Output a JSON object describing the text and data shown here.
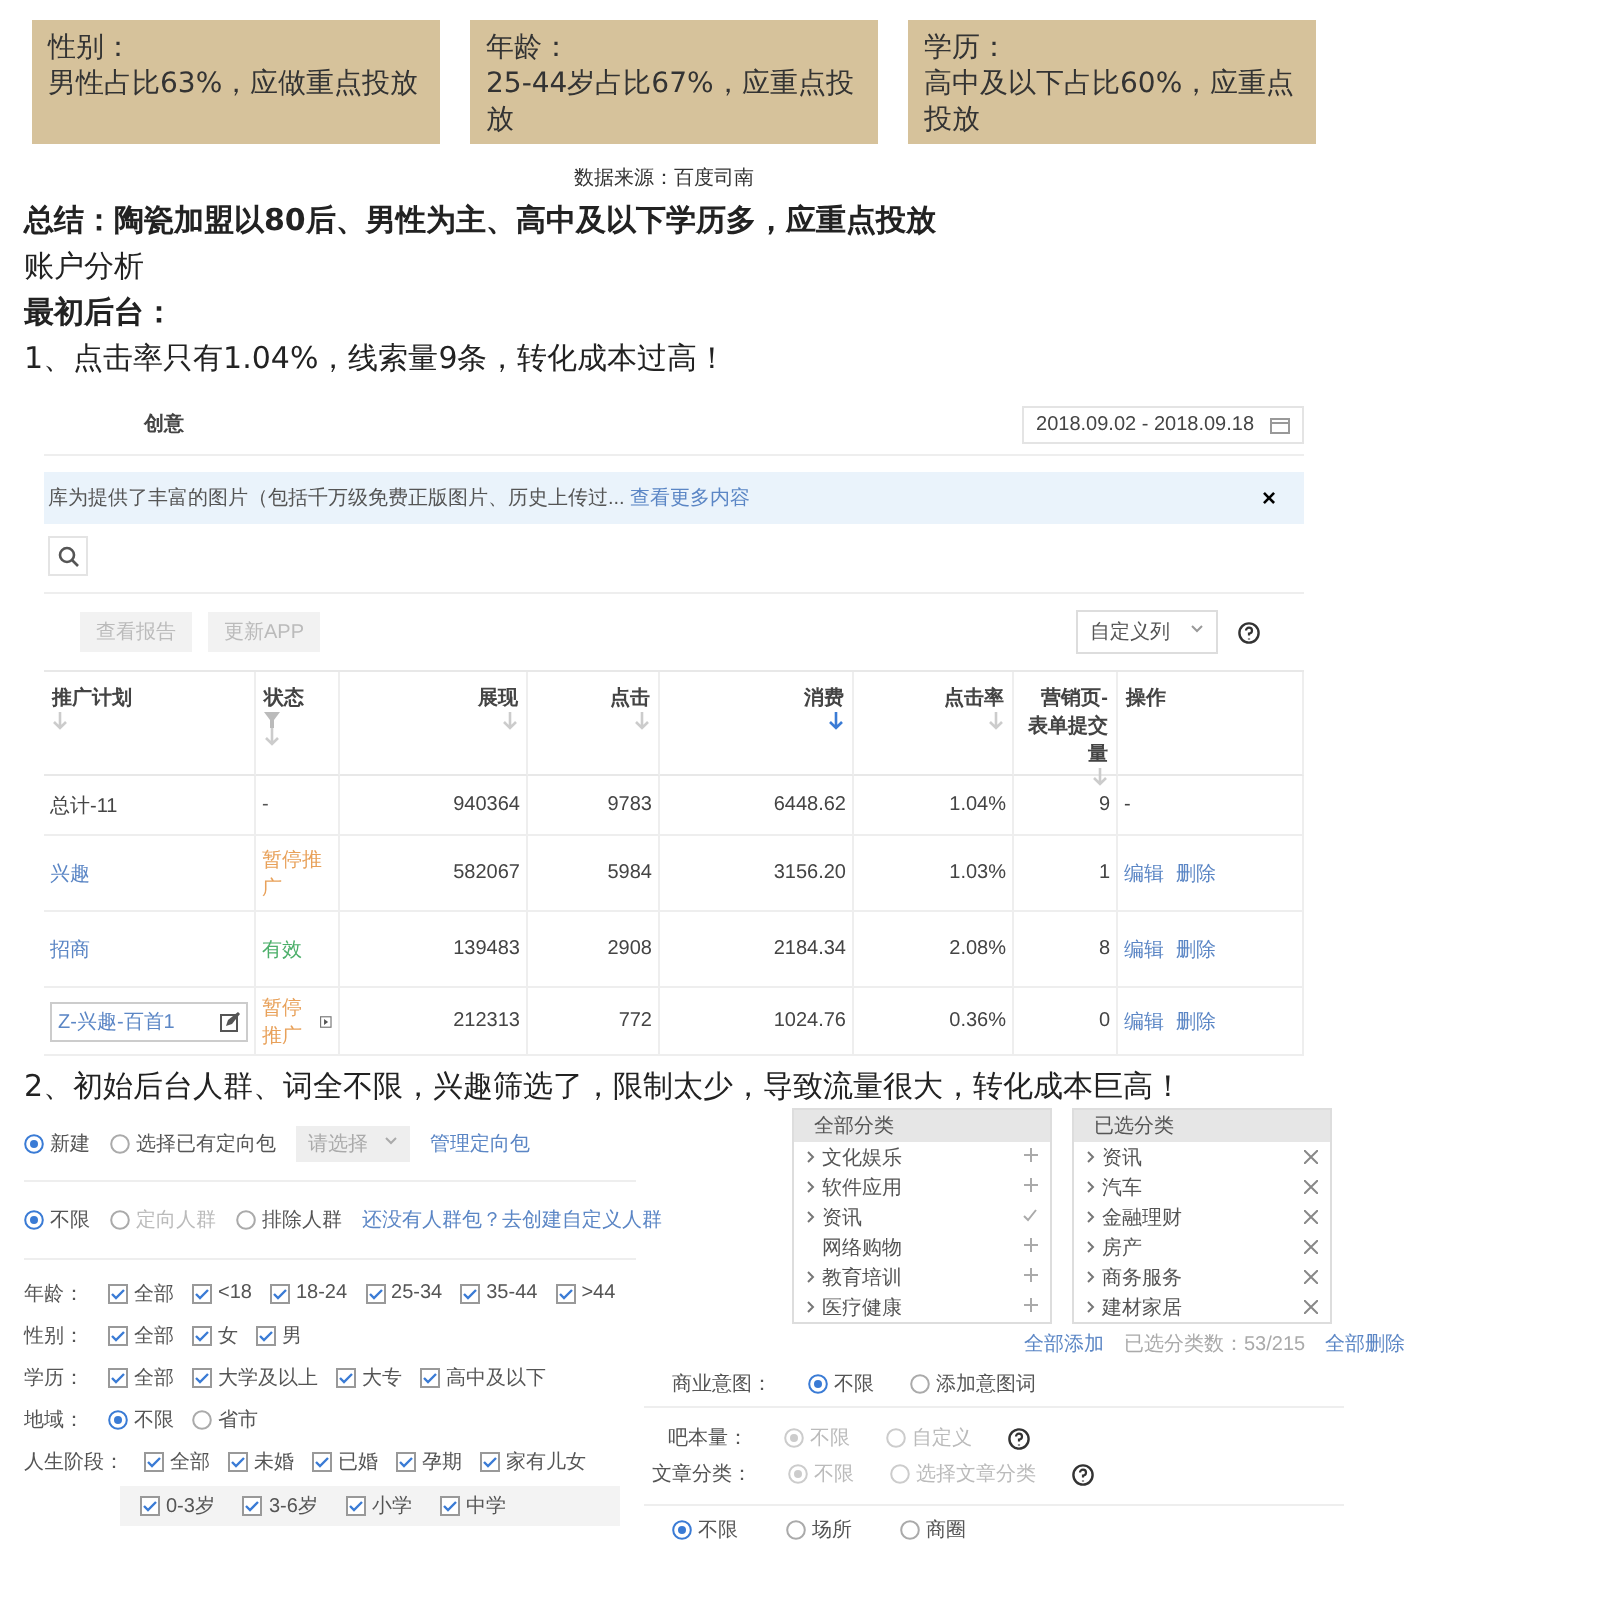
{
  "stat_cards": [
    {
      "title": "性别：",
      "text": "男性占比63%，应做重点投放"
    },
    {
      "title": "年龄：",
      "text": "25-44岁占比67%，应重点投放"
    },
    {
      "title": "学历：",
      "text": "高中及以下占比60%，应重点投放"
    }
  ],
  "source": "数据来源：百度司南",
  "summary": "总结：陶瓷加盟以80后、男性为主、高中及以下学历多，应重点投放",
  "section_title": "账户分析",
  "subheading": "最初后台：",
  "point_1": "1、点击率只有1.04%，线索量9条，转化成本过高！",
  "report_screenshot": {
    "tab": "创意",
    "date_range": "2018.09.02 - 2018.09.18",
    "notice": "库为提供了丰富的图片（包括千万级免费正版图片、历史上传过...",
    "notice_link": "查看更多内容",
    "close": "×",
    "buttons": [
      "查看报告",
      "更新APP"
    ],
    "column_picker": "自定义列",
    "columns": [
      {
        "label": "推广计划",
        "sorted": false
      },
      {
        "label": "状态",
        "sorted": false,
        "filter": true
      },
      {
        "label": "展现",
        "sorted": false
      },
      {
        "label": "点击",
        "sorted": false
      },
      {
        "label": "消费",
        "sorted": true
      },
      {
        "label": "点击率",
        "sorted": false
      },
      {
        "label": "营销页-表单提交量",
        "sorted": false
      },
      {
        "label": "操作"
      }
    ],
    "rows": [
      {
        "kind": "total",
        "plan": "总计-11",
        "status": {
          "text": "-",
          "color": "#555555"
        },
        "values": [
          "940364",
          "9783",
          "6448.62",
          "1.04%",
          "9"
        ],
        "actions": [
          "-"
        ]
      },
      {
        "kind": "link",
        "plan": "兴趣",
        "status": {
          "text": "暂停推广",
          "color": "#e8a15a"
        },
        "values": [
          "582067",
          "5984",
          "3156.20",
          "1.03%",
          "1"
        ],
        "actions": [
          "编辑",
          "删除"
        ]
      },
      {
        "kind": "link",
        "plan": "招商",
        "status": {
          "text": "有效",
          "color": "#4caf6a"
        },
        "values": [
          "139483",
          "2908",
          "2184.34",
          "2.08%",
          "8"
        ],
        "actions": [
          "编辑",
          "删除"
        ]
      },
      {
        "kind": "editing",
        "plan": "Z-兴趣-百首1",
        "status": {
          "text": "暂停推广",
          "color": "#e8a15a"
        },
        "values": [
          "212313",
          "772",
          "1024.76",
          "0.36%",
          "0"
        ],
        "actions": [
          "编辑",
          "删除"
        ]
      }
    ]
  },
  "point_2": "2、初始后台人群、词全不限，兴趣筛选了，限制太少，导致流量很大，转化成本巨高！",
  "targeting_screenshot": {
    "package_options": [
      {
        "label": "新建",
        "selected": true
      },
      {
        "label": "选择已有定向包",
        "selected": false
      }
    ],
    "package_select": {
      "placeholder": "请选择",
      "disabled": true
    },
    "package_link": "管理定向包",
    "audience_options": [
      {
        "label": "不限",
        "selected": true,
        "disabled": false
      },
      {
        "label": "定向人群",
        "selected": false,
        "disabled": true
      },
      {
        "label": "排除人群",
        "selected": false,
        "disabled": false
      }
    ],
    "audience_link": "还没有人群包？去创建自定义人群",
    "filters": [
      {
        "label": "年龄：",
        "kind": "checkbox",
        "options": [
          {
            "label": "全部",
            "checked": true
          },
          {
            "label": "<18",
            "checked": true
          },
          {
            "label": "18-24",
            "checked": true
          },
          {
            "label": "25-34",
            "checked": true
          },
          {
            "label": "35-44",
            "checked": true
          },
          {
            "label": ">44",
            "checked": true
          }
        ]
      },
      {
        "label": "性别：",
        "kind": "checkbox",
        "options": [
          {
            "label": "全部",
            "checked": true
          },
          {
            "label": "女",
            "checked": true
          },
          {
            "label": "男",
            "checked": true
          }
        ]
      },
      {
        "label": "学历：",
        "kind": "checkbox",
        "options": [
          {
            "label": "全部",
            "checked": true
          },
          {
            "label": "大学及以上",
            "checked": true
          },
          {
            "label": "大专",
            "checked": true
          },
          {
            "label": "高中及以下",
            "checked": true
          }
        ]
      },
      {
        "label": "地域：",
        "kind": "radio",
        "options": [
          {
            "label": "不限",
            "selected": true
          },
          {
            "label": "省市",
            "selected": false
          }
        ]
      },
      {
        "label": "人生阶段：",
        "kind": "checkbox",
        "options": [
          {
            "label": "全部",
            "checked": true
          },
          {
            "label": "未婚",
            "checked": true
          },
          {
            "label": "已婚",
            "checked": true
          },
          {
            "label": "孕期",
            "checked": true
          },
          {
            "label": "家有儿女",
            "checked": true
          }
        ],
        "sub_options": [
          {
            "label": "0-3岁",
            "checked": true
          },
          {
            "label": "3-6岁",
            "checked": true
          },
          {
            "label": "小学",
            "checked": true
          },
          {
            "label": "中学",
            "checked": true
          }
        ]
      }
    ],
    "all_categories": {
      "title": "全部分类",
      "items": [
        {
          "label": "文化娱乐",
          "expandable": true,
          "added": false
        },
        {
          "label": "软件应用",
          "expandable": true,
          "added": false
        },
        {
          "label": "资讯",
          "expandable": true,
          "added": true
        },
        {
          "label": "网络购物",
          "expandable": false,
          "added": false
        },
        {
          "label": "教育培训",
          "expandable": true,
          "added": false
        },
        {
          "label": "医疗健康",
          "expandable": true,
          "added": false
        }
      ]
    },
    "selected_categories": {
      "title": "已选分类",
      "items": [
        {
          "label": "资讯"
        },
        {
          "label": "汽车"
        },
        {
          "label": "金融理财"
        },
        {
          "label": "房产"
        },
        {
          "label": "商务服务"
        },
        {
          "label": "建材家居"
        }
      ]
    },
    "add_all": "全部添加",
    "selected_count": "已选分类数：53/215",
    "remove_all": "全部删除",
    "intent": {
      "label": "商业意图：",
      "options": [
        {
          "label": "不限",
          "selected": true
        },
        {
          "label": "添加意图词",
          "selected": false
        }
      ]
    },
    "locked_rows": [
      {
        "label": "吧本量：",
        "disabled": true,
        "options": [
          {
            "label": "不限",
            "selected": true
          },
          {
            "label": "自定义",
            "selected": false
          }
        ]
      },
      {
        "label": "文章分类：",
        "disabled": true,
        "options": [
          {
            "label": "不限",
            "selected": true
          },
          {
            "label": "选择文章分类",
            "selected": false
          }
        ]
      }
    ],
    "location_options": [
      {
        "label": "不限",
        "selected": true
      },
      {
        "label": "场所",
        "selected": false
      },
      {
        "label": "商圈",
        "selected": false
      }
    ]
  }
}
